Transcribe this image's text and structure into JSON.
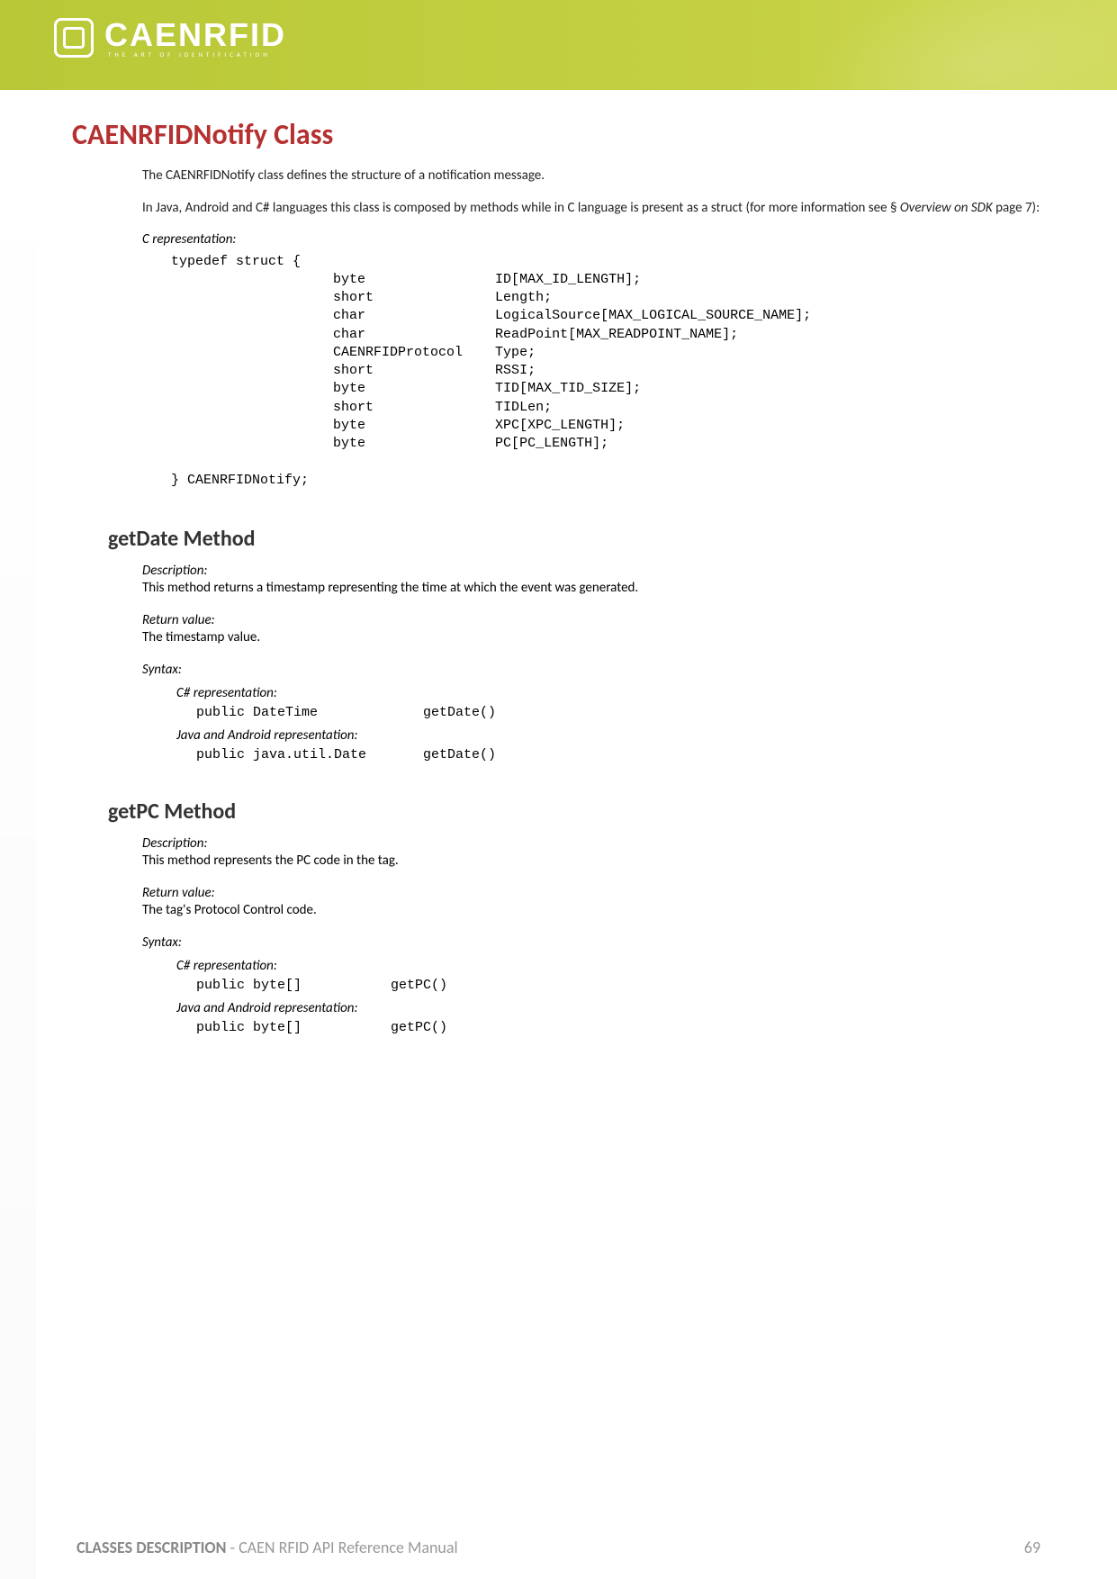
{
  "header": {
    "logo_main": "CAENRFID",
    "logo_sub": "THE ART OF IDENTIFICATION"
  },
  "title": "CAENRFIDNotify Class",
  "intro": {
    "p1": "The CAENRFIDNotify class defines the structure of a notification message.",
    "p2_a": "In Java, Android and C# languages this class is composed by methods while in C language is present as a struct (for more information see § ",
    "p2_em": "Overview on SDK",
    "p2_b": " page 7):"
  },
  "c_rep_label": "C representation:",
  "c_rep_code": "typedef struct {\n                    byte                ID[MAX_ID_LENGTH];\n                    short               Length;\n                    char                LogicalSource[MAX_LOGICAL_SOURCE_NAME];\n                    char                ReadPoint[MAX_READPOINT_NAME];\n                    CAENRFIDProtocol    Type;\n                    short               RSSI;\n                    byte                TID[MAX_TID_SIZE];\n                    short               TIDLen;\n                    byte                XPC[XPC_LENGTH];\n                    byte                PC[PC_LENGTH];\n\n} CAENRFIDNotify;",
  "methods": {
    "getDate": {
      "title": "getDate Method",
      "desc_label": "Description:",
      "desc_text": "This method returns a timestamp representing the time at which the event was generated.",
      "ret_label": "Return value:",
      "ret_text": "The timestamp value.",
      "syntax_label": "Syntax:",
      "csharp_label": "C# representation:",
      "csharp_code": "public DateTime             getDate()",
      "java_label": "Java and Android representation:",
      "java_code": "public java.util.Date       getDate()"
    },
    "getPC": {
      "title": "getPC Method",
      "desc_label": "Description:",
      "desc_text": "This method represents the PC code in the tag.",
      "ret_label": "Return value:",
      "ret_text": "The tag's Protocol Control code.",
      "syntax_label": "Syntax:",
      "csharp_label": "C# representation:",
      "csharp_code": "public byte[]           getPC()",
      "java_label": "Java and Android representation:",
      "java_code": "public byte[]           getPC()"
    }
  },
  "footer": {
    "section": "CLASSES DESCRIPTION",
    "doc": " - CAEN RFID API Reference Manual",
    "page": "69"
  }
}
